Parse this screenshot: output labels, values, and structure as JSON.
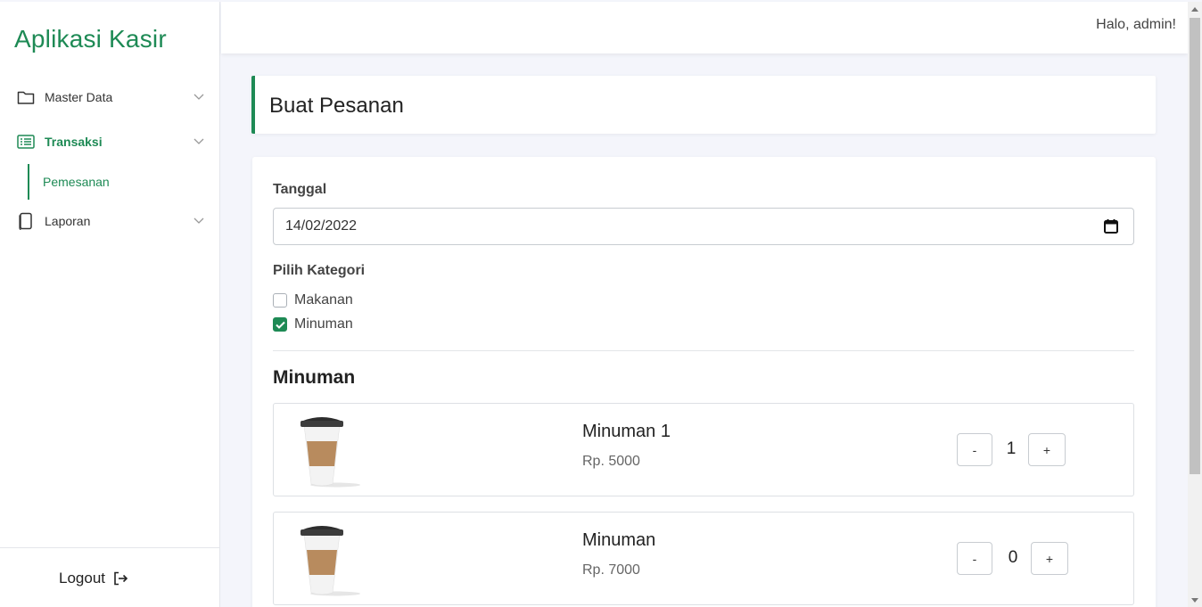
{
  "app": {
    "brand": "Aplikasi Kasir",
    "accent": "#1e8a55"
  },
  "topbar": {
    "greeting": "Halo, admin!"
  },
  "sidebar": {
    "items": [
      {
        "label": "Master Data",
        "icon": "folder-icon"
      },
      {
        "label": "Transaksi",
        "icon": "list-icon",
        "active": true
      },
      {
        "label": "Laporan",
        "icon": "document-icon"
      }
    ],
    "sub_items": [
      {
        "label": "Pemesanan",
        "active": true
      }
    ],
    "logout": "Logout"
  },
  "page": {
    "title": "Buat Pesanan",
    "date_label": "Tanggal",
    "date_value": "14/02/2022",
    "category_label": "Pilih Kategori",
    "categories": [
      {
        "label": "Makanan",
        "checked": false
      },
      {
        "label": "Minuman",
        "checked": true
      }
    ],
    "section_title": "Minuman",
    "products": [
      {
        "name": "Minuman 1",
        "price": "Rp. 5000",
        "qty": "1",
        "minus": "-",
        "plus": "+"
      },
      {
        "name": "Minuman",
        "price": "Rp. 7000",
        "qty": "0",
        "minus": "-",
        "plus": "+"
      }
    ]
  }
}
